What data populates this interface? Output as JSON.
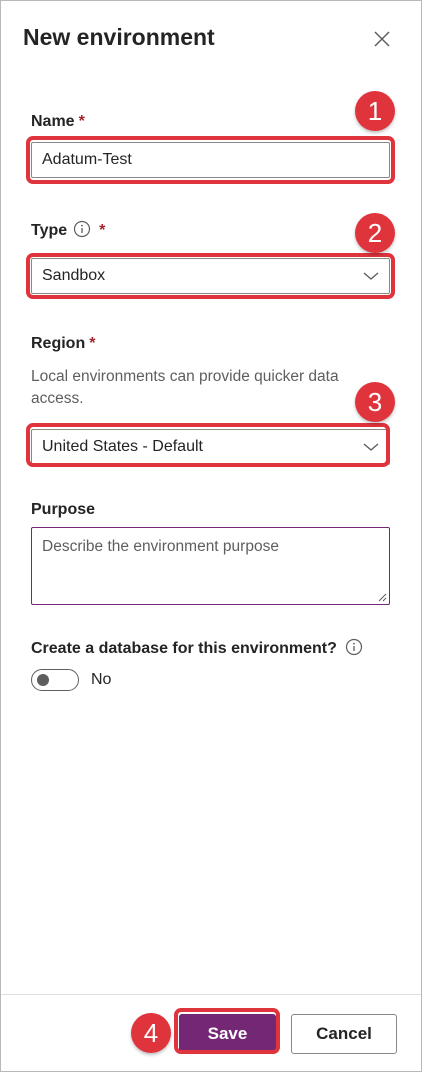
{
  "panel": {
    "title": "New environment",
    "close_icon": "close-icon"
  },
  "name": {
    "label": "Name",
    "required_mark": "*",
    "value": "Adatum-Test"
  },
  "type": {
    "label": "Type",
    "required_mark": "*",
    "info_icon": "info-icon",
    "selected": "Sandbox"
  },
  "region": {
    "label": "Region",
    "required_mark": "*",
    "help_text": "Local environments can provide quicker data access.",
    "selected": "United States - Default"
  },
  "purpose": {
    "label": "Purpose",
    "placeholder": "Describe the environment purpose"
  },
  "database": {
    "label": "Create a database for this environment?",
    "info_icon": "info-icon",
    "toggle_state": "No"
  },
  "footer": {
    "save_label": "Save",
    "cancel_label": "Cancel"
  },
  "callouts": [
    "1",
    "2",
    "3",
    "4"
  ],
  "colors": {
    "accent": "#742774",
    "callout": "#e0343d",
    "required": "#a4262c"
  }
}
